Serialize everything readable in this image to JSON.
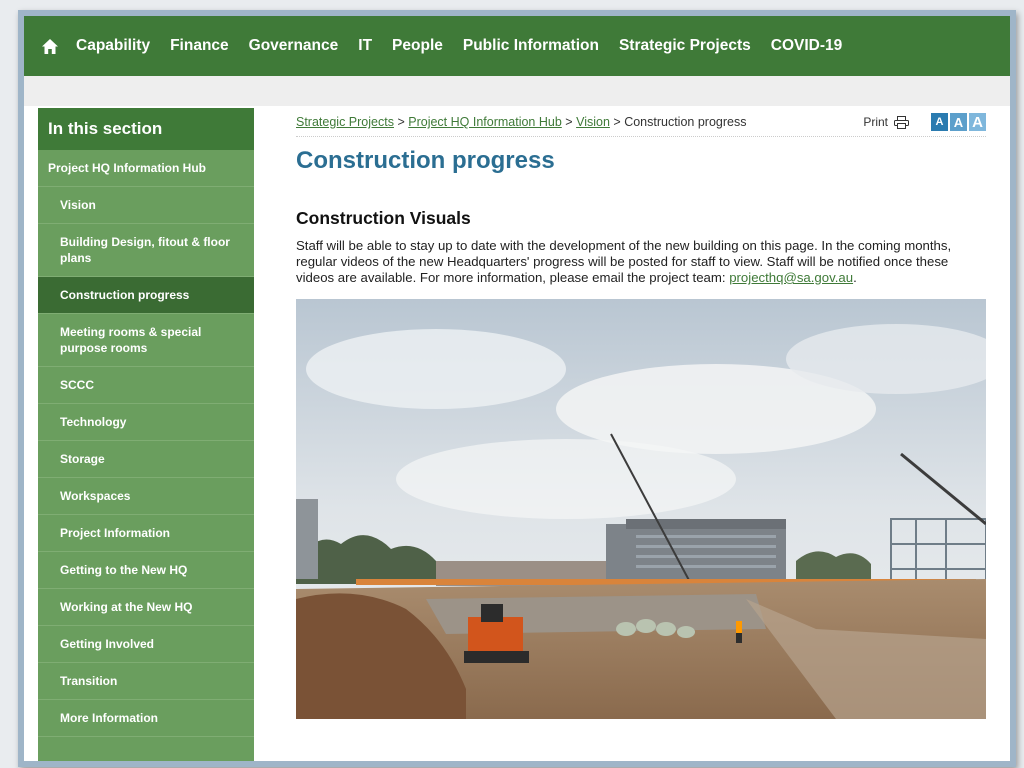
{
  "nav": {
    "items": [
      "Capability",
      "Finance",
      "Governance",
      "IT",
      "People",
      "Public Information",
      "Strategic Projects",
      "COVID-19"
    ]
  },
  "sidebar": {
    "heading": "In this section",
    "items": [
      {
        "label": "Project HQ Information Hub"
      },
      {
        "label": "Vision"
      },
      {
        "label": "Building Design, fitout & floor plans"
      },
      {
        "label": "Construction progress"
      },
      {
        "label": "Meeting rooms & special purpose rooms"
      },
      {
        "label": "SCCC"
      },
      {
        "label": "Technology"
      },
      {
        "label": "Storage"
      },
      {
        "label": "Workspaces"
      },
      {
        "label": "Project Information"
      },
      {
        "label": "Getting to the New HQ"
      },
      {
        "label": "Working at the New HQ"
      },
      {
        "label": "Getting Involved"
      },
      {
        "label": "Transition"
      },
      {
        "label": "More Information"
      }
    ]
  },
  "breadcrumb": {
    "links": [
      "Strategic Projects",
      "Project HQ Information Hub",
      "Vision"
    ],
    "separator": ">",
    "current": "Construction progress"
  },
  "tools": {
    "print_label": "Print",
    "size_labels": [
      "A",
      "A",
      "A"
    ]
  },
  "page": {
    "title": "Construction progress",
    "section_title": "Construction Visuals",
    "intro_text": "Staff will be able to stay up to date with the development of the new building on this page. In the coming months, regular videos of the new Headquarters' progress will be posted for staff to view. Staff will be notified once these videos are available. For more information, please email the project team: ",
    "email": "projecthq@sa.gov.au",
    "intro_end": "."
  },
  "colors": {
    "nav_green": "#3f7a38",
    "sidebar_green": "#6a9e5e",
    "title_blue": "#2b6e92"
  }
}
